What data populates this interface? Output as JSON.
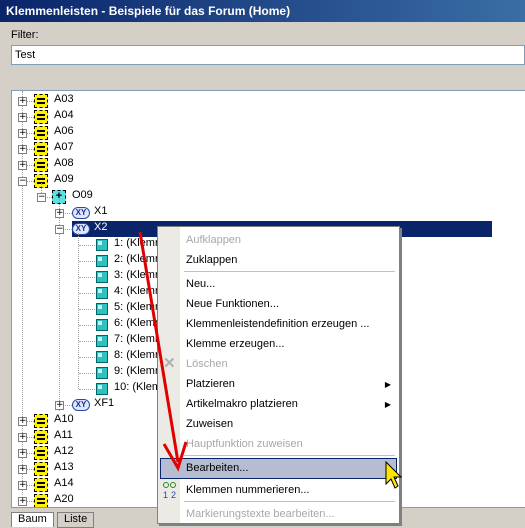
{
  "window": {
    "title": "Klemmenleisten - Beispiele für das Forum (Home)"
  },
  "filter": {
    "label": "Filter:",
    "value": "Test"
  },
  "tree": {
    "top_items": [
      "A03",
      "A04",
      "A06",
      "A07",
      "A08",
      "A09"
    ],
    "o09": "O09",
    "x1": "X1",
    "x2": "X2",
    "terminals": [
      "1: (Klemn",
      "2: (Klemn",
      "3: (Klemn",
      "4: (Klemn",
      "5: (Klemn",
      "6: (Klemn",
      "7: (Klemn",
      "8: (Klemn",
      "9: (Klemn",
      "10: (Klem"
    ],
    "xf1": "XF1",
    "bottom_items": [
      "A10",
      "A11",
      "A12",
      "A13",
      "A14",
      "A20"
    ],
    "xy_label": "XY",
    "o_icon_label": "+"
  },
  "tabs": [
    "Baum",
    "Liste"
  ],
  "context_menu": {
    "items": [
      {
        "label": "Aufklappen",
        "disabled": true
      },
      {
        "label": "Zuklappen",
        "disabled": false
      },
      {
        "label": "Neu...",
        "disabled": false
      },
      {
        "label": "Neue Funktionen...",
        "disabled": false
      },
      {
        "label": "Klemmenleistendefinition erzeugen ...",
        "disabled": false
      },
      {
        "label": "Klemme erzeugen...",
        "disabled": false
      },
      {
        "label": "Löschen",
        "disabled": true
      },
      {
        "label": "Platzieren",
        "disabled": false,
        "submenu": true
      },
      {
        "label": "Artikelmakro platzieren",
        "disabled": false,
        "submenu": true
      },
      {
        "label": "Zuweisen",
        "disabled": false
      },
      {
        "label": "Hauptfunktion zuweisen",
        "disabled": true
      },
      {
        "label": "Bearbeiten...",
        "disabled": false,
        "highlighted": true
      },
      {
        "label": "Klemmen nummerieren...",
        "disabled": false
      },
      {
        "label": "Markierungstexte bearbeiten...",
        "disabled": true
      }
    ],
    "submenu_arrow": "▶"
  },
  "colors": {
    "selection": "#0a246a",
    "menu_highlight": "#b6bdd2",
    "annotation_arrow": "#e00000"
  }
}
